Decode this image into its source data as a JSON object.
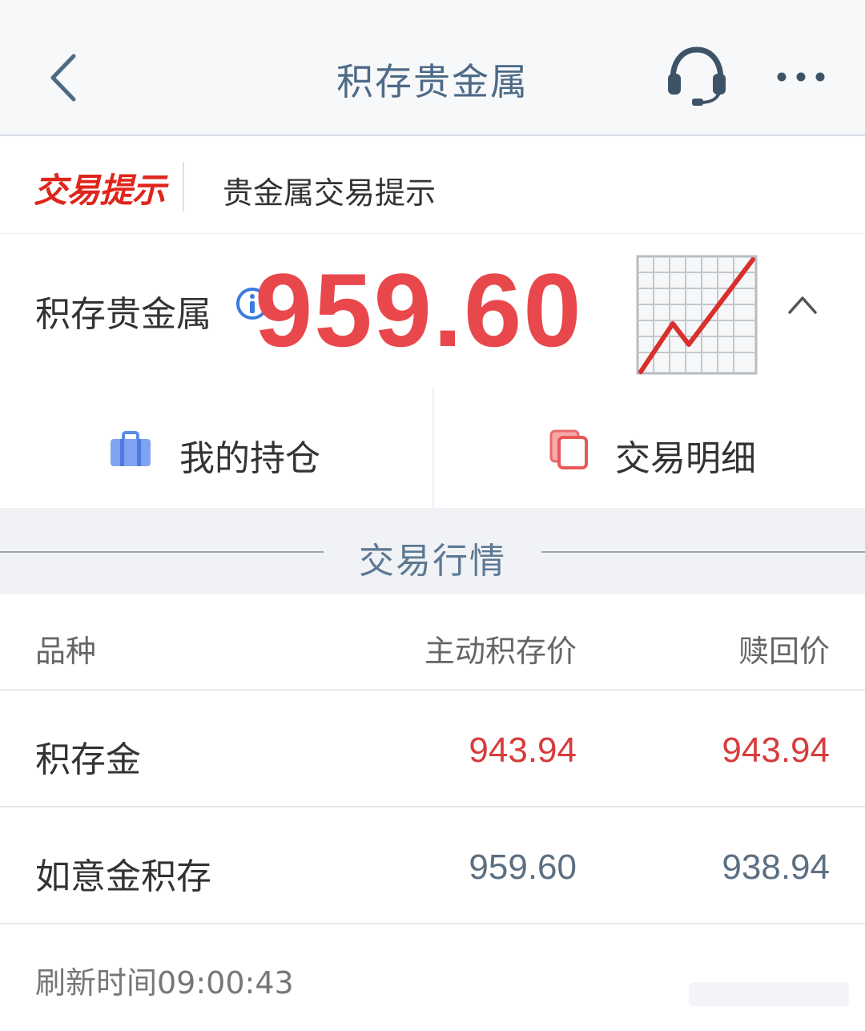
{
  "header": {
    "title": "积存贵金属",
    "back_icon": "chevron-left-icon",
    "support_icon": "headset-icon",
    "more_icon": "more-dots-icon"
  },
  "tip_bar": {
    "tag": "交易提示",
    "text": "贵金属交易提示"
  },
  "product": {
    "name": "积存贵金属",
    "overlay_price": "959.60",
    "chart_icon": "chart-increasing-icon",
    "collapse_icon": "chevron-up-icon"
  },
  "actions": [
    {
      "label": "我的持仓",
      "icon": "briefcase-icon"
    },
    {
      "label": "交易明细",
      "icon": "copy-document-icon"
    }
  ],
  "market": {
    "section_title": "交易行情",
    "columns": [
      "品种",
      "主动积存价",
      "赎回价"
    ],
    "rows": [
      {
        "name": "积存金",
        "buy": "943.94",
        "redeem": "943.94"
      },
      {
        "name": "如意金积存",
        "buy": "959.60",
        "redeem": "938.94"
      }
    ],
    "refresh_label": "刷新时间09:00:43"
  },
  "colors": {
    "accent_red": "#e8484c",
    "price_red": "#d83c3c",
    "price_neutral": "#5c6f82",
    "title_blue": "#4d6a86"
  }
}
